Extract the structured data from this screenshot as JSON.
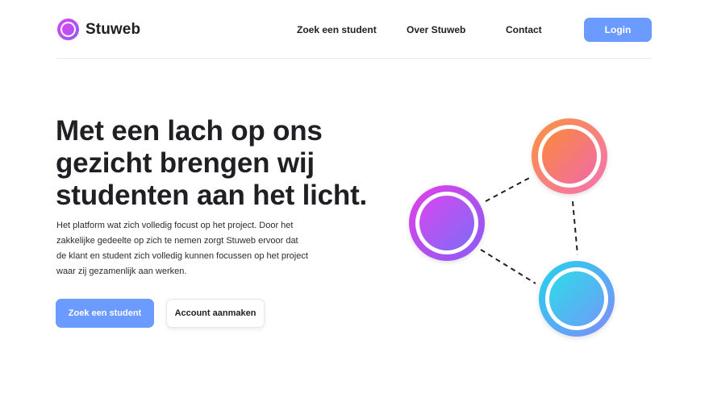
{
  "brand": {
    "name": "Stuweb"
  },
  "nav": {
    "items": [
      "Zoek een student",
      "Over Stuweb",
      "Contact"
    ],
    "login_label": "Login"
  },
  "hero": {
    "title_lines": [
      "Met een lach op ons",
      "gezicht brengen wij",
      "studenten aan het licht."
    ],
    "body_lines": [
      "Het platform wat zich volledig focust op het project. Door het",
      "zakkelijke gedeelte op zich te nemen zorgt Stuweb ervoor dat",
      "de klant en student zich volledig kunnen focussen op het project",
      "waar zij gezamenlijk aan werken."
    ],
    "primary_cta": "Zoek een student",
    "secondary_cta": "Account aanmaken"
  },
  "colors": {
    "accent": "#6b9bff",
    "text": "#1f1f24",
    "node_purple": [
      "#d946ef",
      "#8b5cf6"
    ],
    "node_orange": [
      "#fb923c",
      "#f472b6"
    ],
    "node_cyan": [
      "#22d3ee",
      "#818cf8"
    ]
  }
}
